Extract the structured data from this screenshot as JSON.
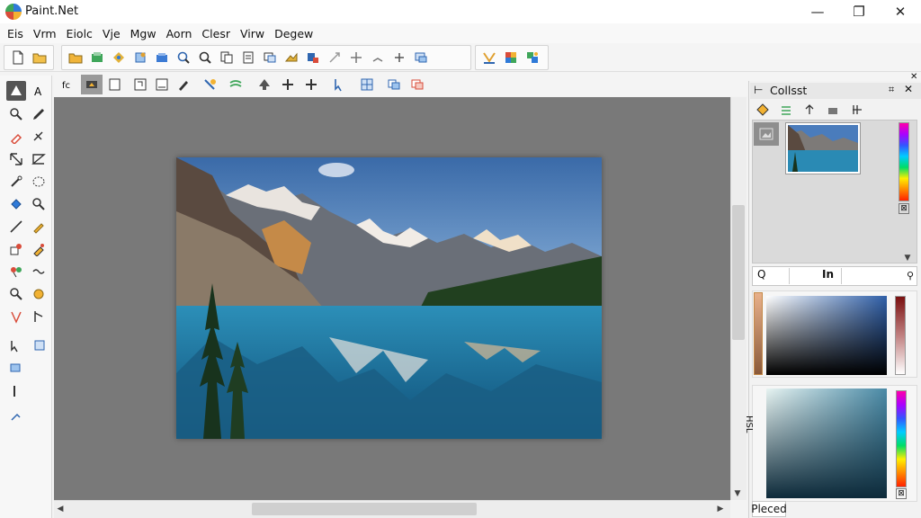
{
  "app": {
    "title": "Paint.Net"
  },
  "window_controls": {
    "minimize": "—",
    "restore": "❐",
    "close": "✕"
  },
  "menu": [
    "Eis",
    "Vrm",
    "Eiolc",
    "Vje",
    "Mgw",
    "Aorn",
    "Clesr",
    "Virw",
    "Degew"
  ],
  "layers_panel": {
    "title": "Collsst",
    "pin": "⊕",
    "close": "✕",
    "search_value": "Q",
    "search_label": "In",
    "palette_label": "Pleced",
    "vertical_label": "HSL"
  },
  "colors": {
    "accent": "#2f7ad8",
    "canvas_bg": "#797979",
    "tool_active": "#555555"
  },
  "icons": {
    "toolbar1": [
      "new-icon",
      "open-folder-icon",
      "open-icon",
      "save-icon",
      "print-icon",
      "cut-icon",
      "copy-icon",
      "zoom-icon",
      "zoom-out-icon",
      "crop-icon",
      "resize-icon",
      "layer-icon",
      "paste-icon",
      "brush-icon",
      "deselect-icon",
      "move-icon",
      "select-icon",
      "adjust-icon",
      "undo-icon",
      "redo-icon",
      "effects-icon",
      "settings-icon"
    ],
    "tools": [
      "move-selection-icon",
      "text-icon",
      "zoom-tool-icon",
      "pencil-icon",
      "color-picker-icon",
      "clone-icon",
      "rectangle-select-icon",
      "lasso-icon",
      "magic-wand-icon",
      "ellipse-select-icon",
      "paint-bucket-icon",
      "gradient-icon",
      "line-icon",
      "eraser-icon",
      "shapes-icon",
      "recolor-icon",
      "brush-tool-icon",
      "freeform-icon",
      "pan-icon",
      "zoom-in-tool-icon",
      "pen-icon",
      "arrow-icon"
    ]
  }
}
